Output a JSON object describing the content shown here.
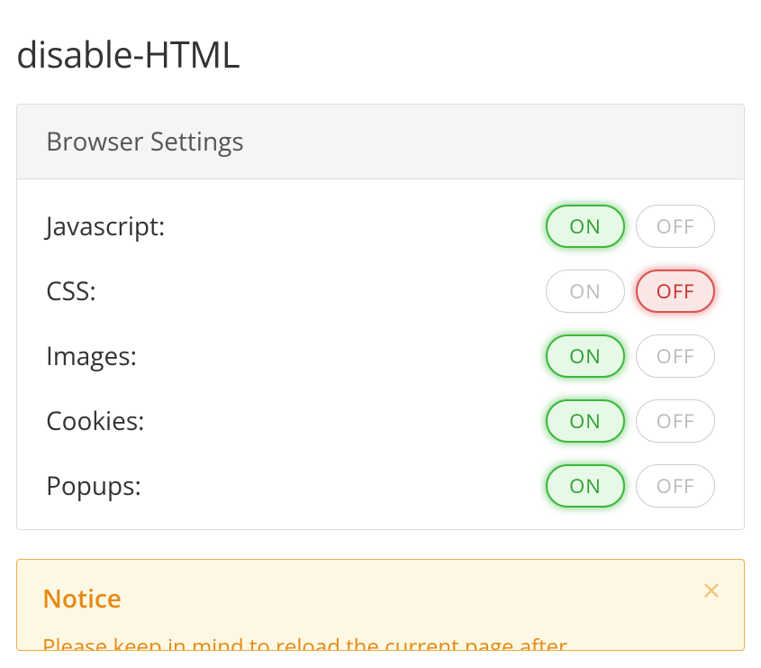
{
  "page_title": "disable-HTML",
  "panel_header": "Browser Settings",
  "labels": {
    "on": "ON",
    "off": "OFF"
  },
  "settings": [
    {
      "key": "javascript",
      "label": "Javascript:",
      "state": "on"
    },
    {
      "key": "css",
      "label": "CSS:",
      "state": "off"
    },
    {
      "key": "images",
      "label": "Images:",
      "state": "on"
    },
    {
      "key": "cookies",
      "label": "Cookies:",
      "state": "on"
    },
    {
      "key": "popups",
      "label": "Popups:",
      "state": "on"
    }
  ],
  "notice": {
    "title": "Notice",
    "text": "Please keep in mind to reload the current page after"
  }
}
